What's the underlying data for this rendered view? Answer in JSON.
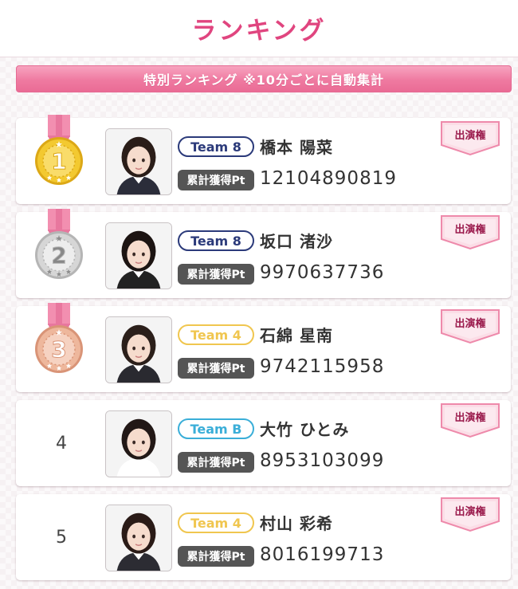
{
  "header": {
    "title": "ランキング"
  },
  "banner": {
    "text": "特別ランキング ※10分ごとに自動集計"
  },
  "pt_label": "累計獲得Pt",
  "right_button_label": "出演権",
  "colors": {
    "accent": "#e0457f",
    "team_8": "#2b3a7a",
    "team_4": "#f0c64f",
    "team_b": "#3aaed8",
    "gold": "#f2c62e",
    "silver": "#c9c9c9",
    "bronze": "#e5a487"
  },
  "ranking": [
    {
      "rank": "1",
      "medal": "gold-medal-icon",
      "team": "Team 8",
      "team_key": "team_8",
      "name": "橋本 陽菜",
      "points": "12104890819"
    },
    {
      "rank": "2",
      "medal": "silver-medal-icon",
      "team": "Team 8",
      "team_key": "team_8",
      "name": "坂口 渚沙",
      "points": "9970637736"
    },
    {
      "rank": "3",
      "medal": "bronze-medal-icon",
      "team": "Team 4",
      "team_key": "team_4",
      "name": "石綿 星南",
      "points": "9742115958"
    },
    {
      "rank": "4",
      "medal": "",
      "team": "Team B",
      "team_key": "team_b",
      "name": "大竹 ひとみ",
      "points": "8953103099"
    },
    {
      "rank": "5",
      "medal": "",
      "team": "Team 4",
      "team_key": "team_4",
      "name": "村山 彩希",
      "points": "8016199713"
    }
  ]
}
